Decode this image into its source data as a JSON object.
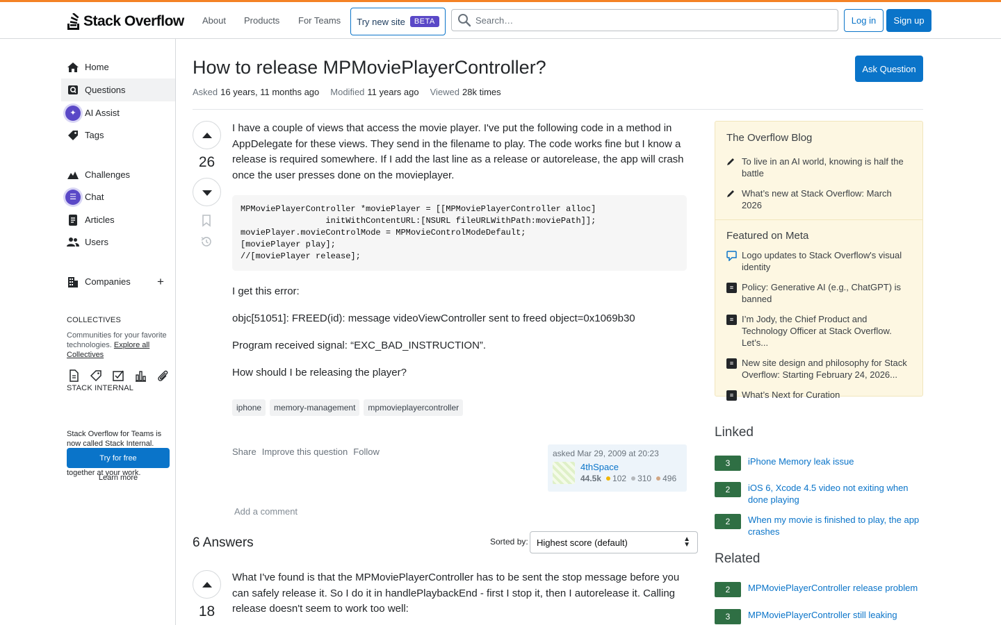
{
  "header": {
    "logo_text": "Stack Overflow",
    "nav": [
      "About",
      "Products",
      "For Teams"
    ],
    "beta_label": "Try new site",
    "beta_badge": "BETA",
    "search_placeholder": "Search…",
    "login": "Log in",
    "signup": "Sign up"
  },
  "sidebar": {
    "items": [
      {
        "label": "Home",
        "icon": "home-icon"
      },
      {
        "label": "Questions",
        "icon": "questions-icon"
      },
      {
        "label": "AI Assist",
        "icon": "ai-assist-icon"
      },
      {
        "label": "Tags",
        "icon": "tag-icon"
      },
      {
        "label": "Challenges",
        "icon": "challenges-icon"
      },
      {
        "label": "Chat",
        "icon": "chat-icon"
      },
      {
        "label": "Articles",
        "icon": "articles-icon"
      },
      {
        "label": "Users",
        "icon": "users-icon"
      },
      {
        "label": "Companies",
        "icon": "companies-icon"
      }
    ],
    "collectives_head": "COLLECTIVES",
    "collectives_text": "Communities for your favorite technologies.",
    "collectives_link": "Explore all Collectives",
    "internal_head": "STACK INTERNAL",
    "internal_text": "Stack Overflow for Teams is now called Stack Internal. Bring the best of human thought and AI automation together at your work.",
    "try_free": "Try for free",
    "learn_more": "Learn more"
  },
  "question": {
    "title": "How to release MPMoviePlayerController?",
    "ask_button": "Ask Question",
    "asked_label": "Asked",
    "asked_value": "16 years, 11 months ago",
    "modified_label": "Modified",
    "modified_value": "11 years ago",
    "viewed_label": "Viewed",
    "viewed_value": "28k times",
    "score": "26",
    "body_p1": "I have a couple of views that access the movie player. I've put the following code in a method in AppDelegate for these views. They send in the filename to play. The code works fine but I know a release is required somewhere. If I add the last line as a release or autorelease, the app will crash once the user presses done on the movieplayer.",
    "code": "MPMoviePlayerController *moviePlayer = [[MPMoviePlayerController alloc]\n                 initWithContentURL:[NSURL fileURLWithPath:moviePath]];\nmoviePlayer.movieControlMode = MPMovieControlModeDefault;\n[moviePlayer play];\n//[moviePlayer release];",
    "body_p2": "I get this error:",
    "body_p3": "objc[51051]: FREED(id): message videoViewController sent to freed object=0x1069b30",
    "body_p4": "Program received signal: “EXC_BAD_INSTRUCTION”.",
    "body_p5": "How should I be releasing the player?",
    "tags": [
      "iphone",
      "memory-management",
      "mpmovieplayercontroller"
    ],
    "actions": [
      "Share",
      "Improve this question",
      "Follow"
    ],
    "asked_on": "asked Mar 29, 2009 at 20:23",
    "user_name": "4thSpace",
    "user_rep": "44.5k",
    "gold": "102",
    "silver": "310",
    "bronze": "496",
    "add_comment": "Add a comment"
  },
  "answers": {
    "heading": "6 Answers",
    "sorted_label": "Sorted by:",
    "sort_value": "Highest score (default)",
    "first_score": "18",
    "first_body": "What I've found is that the MPMoviePlayerController has to be sent the stop message before you can safely release it. So I do it in handlePlaybackEnd - first I stop it, then I autorelease it. Calling release doesn't seem to work too well:"
  },
  "right": {
    "blog_head": "The Overflow Blog",
    "blog_items": [
      "To live in an AI world, knowing is half the battle",
      "What’s new at Stack Overflow: March 2026"
    ],
    "meta_head": "Featured on Meta",
    "meta_items": [
      "Logo updates to Stack Overflow's visual identity",
      "Policy: Generative AI (e.g., ChatGPT) is banned",
      "I’m Jody, the Chief Product and Technology Officer at Stack Overflow. Let’s...",
      "New site design and philosophy for Stack Overflow: Starting February 24, 2026...",
      "What’s Next for Curation"
    ],
    "linked_head": "Linked",
    "linked": [
      {
        "score": "3",
        "title": "iPhone Memory leak issue"
      },
      {
        "score": "2",
        "title": "iOS 6, Xcode 4.5 video not exiting when done playing"
      },
      {
        "score": "2",
        "title": "When my movie is finished to play, the app crashes"
      }
    ],
    "related_head": "Related",
    "related": [
      {
        "score": "2",
        "title": "MPMoviePlayerController release problem"
      },
      {
        "score": "3",
        "title": "MPMoviePlayerController still leaking"
      }
    ]
  },
  "colors": {
    "accent": "#f48225",
    "link": "#0a74c9",
    "beta": "#5a48c7",
    "score_green": "#2f6f44",
    "blog_bg": "#fdf7e2"
  }
}
